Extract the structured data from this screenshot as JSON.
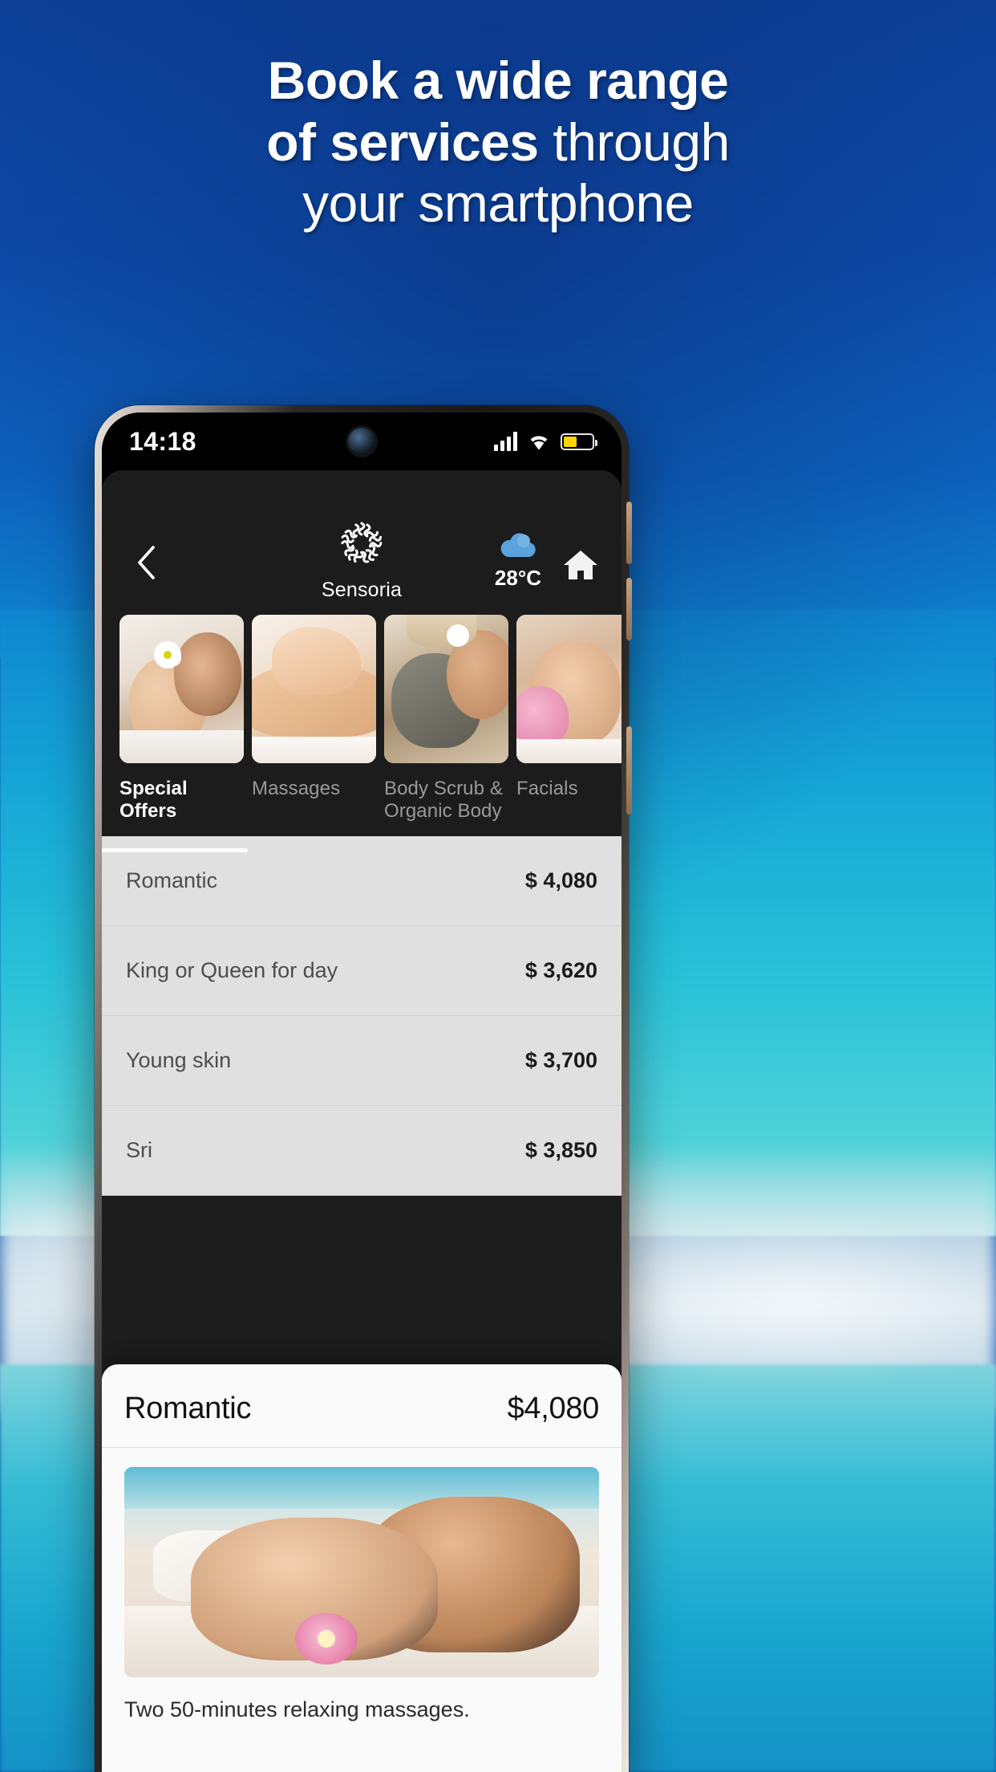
{
  "promo": {
    "headline_bold": "Book a wide range of services",
    "headline_light": " through your smartphone",
    "line1_bold": "Book a wide range",
    "line2_bold": "of services",
    "line2_light": " through",
    "line3_light": "your smartphone"
  },
  "status_bar": {
    "time": "14:18",
    "signal_icon": "signal-bars-icon",
    "wifi_icon": "wifi-icon",
    "battery_icon": "battery-icon",
    "battery_fill_color": "#ffd400",
    "battery_level_percent": 46
  },
  "app_header": {
    "back_icon": "chevron-left-icon",
    "logo_icon": "spa-steam-swirl-logo-icon",
    "brand_name": "Sensoria",
    "weather_icon": "cloud-icon",
    "weather_icon_color": "#5ba3dd",
    "temperature": "28°C",
    "home_icon": "home-icon"
  },
  "categories": [
    {
      "label": "Special Offers",
      "active": true,
      "thumb": "couple-massage-photo"
    },
    {
      "label": "Massages",
      "active": false,
      "thumb": "back-massage-photo"
    },
    {
      "label": "Body Scrub &\nOrganic Body",
      "label_line1": "Body Scrub &",
      "label_line2": "Organic Body",
      "active": false,
      "thumb": "body-scrub-photo"
    },
    {
      "label": "Facials",
      "active": false,
      "thumb": "facial-treatment-photo"
    }
  ],
  "price_list": [
    {
      "name": "Romantic",
      "price": "$ 4,080"
    },
    {
      "name": "King or Queen for day",
      "price": "$ 3,620"
    },
    {
      "name": "Young skin",
      "price": "$ 3,700"
    },
    {
      "name": "Sri",
      "price": "$ 3,850"
    }
  ],
  "detail_sheet": {
    "title": "Romantic",
    "price": "$4,080",
    "image": "romantic-couple-massage-photo",
    "description": "Two 50-minutes relaxing massages."
  },
  "colors": {
    "promo_background": "#0d4aa8",
    "app_dark": "#1c1c1c",
    "list_background": "#e0e0e0",
    "sheet_background": "#fafafa",
    "accent_white": "#ffffff"
  }
}
